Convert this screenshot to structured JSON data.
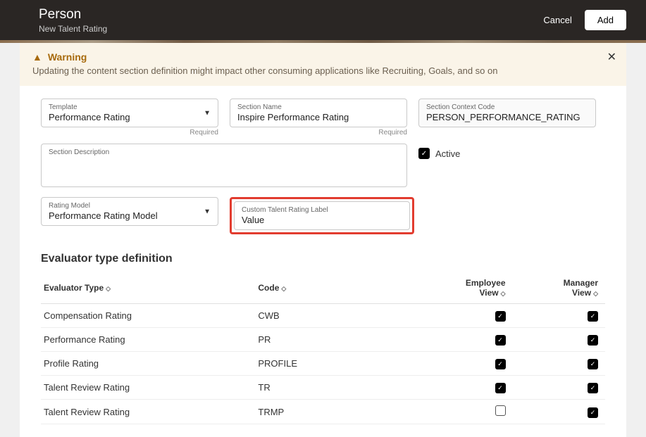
{
  "header": {
    "title": "Person",
    "subtitle": "New Talent Rating",
    "cancel": "Cancel",
    "add": "Add"
  },
  "warning": {
    "title": "Warning",
    "message": "Updating the content section definition might impact other consuming applications like Recruiting, Goals, and so on"
  },
  "form": {
    "template_label": "Template",
    "template_value": "Performance Rating",
    "section_name_label": "Section Name",
    "section_name_value": "Inspire Performance Rating",
    "context_label": "Section Context Code",
    "context_value": "PERSON_PERFORMANCE_RATING",
    "required": "Required",
    "desc_label": "Section Description",
    "active_label": "Active",
    "rating_model_label": "Rating Model",
    "rating_model_value": "Performance Rating Model",
    "custom_label": "Custom Talent Rating Label",
    "custom_value": "Value"
  },
  "table": {
    "heading": "Evaluator type definition",
    "col_type": "Evaluator Type",
    "col_code": "Code",
    "col_emp": "Employee View",
    "col_mgr": "Manager View",
    "rows": [
      {
        "type": "Compensation Rating",
        "code": "CWB",
        "emp": true,
        "mgr": true
      },
      {
        "type": "Performance Rating",
        "code": "PR",
        "emp": true,
        "mgr": true
      },
      {
        "type": "Profile Rating",
        "code": "PROFILE",
        "emp": true,
        "mgr": true
      },
      {
        "type": "Talent Review Rating",
        "code": "TR",
        "emp": true,
        "mgr": true
      },
      {
        "type": "Talent Review Rating",
        "code": "TRMP",
        "emp": false,
        "mgr": true
      }
    ]
  }
}
